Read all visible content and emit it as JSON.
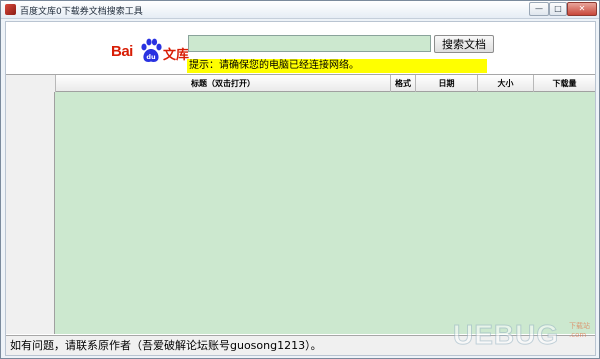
{
  "window": {
    "title": "百度文库0下载券文档搜索工具",
    "minimize_glyph": "—",
    "maximize_glyph": "□",
    "close_glyph": "✕"
  },
  "logo": {
    "bai_text": "Bai",
    "paw_text": "du",
    "wenku_text": "文库",
    "brand_color": "#d81e06"
  },
  "search": {
    "value": "",
    "placeholder": "",
    "button_label": "搜索文档"
  },
  "hint": {
    "text": "提示：请确保您的电脑已经连接网络。"
  },
  "table": {
    "columns": [
      "",
      "标题（双击打开）",
      "格式",
      "日期",
      "大小",
      "下载量"
    ],
    "rows": []
  },
  "status": {
    "text": "如有问题，请联系原作者（吾爱破解论坛账号guosong1213）。"
  },
  "watermark": {
    "text": "UEBUG",
    "sub_line1": "下载站",
    "sub_line2": ".com"
  },
  "colors": {
    "list_background": "#cce8cf",
    "hint_background": "#ffff00"
  }
}
